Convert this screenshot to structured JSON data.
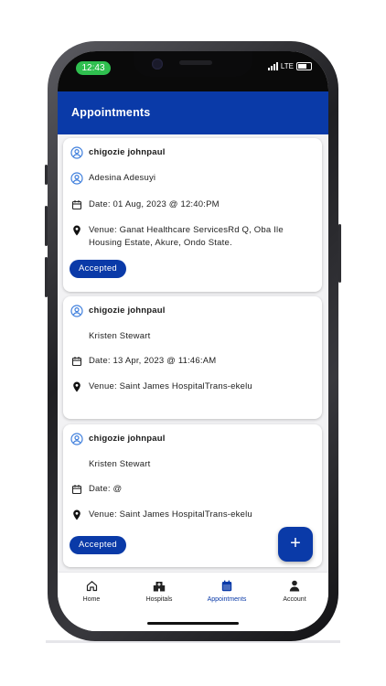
{
  "status_bar": {
    "time": "12:43",
    "network": "LTE"
  },
  "app_bar": {
    "title": "Appointments"
  },
  "appointments": [
    {
      "patient": "chigozie johnpaul",
      "doctor": "Adesina Adesuyi",
      "date": "Date: 01 Aug, 2023 @ 12:40:PM",
      "venue": "Venue: Ganat Healthcare ServicesRd Q, Oba Ile Housing Estate, Akure, Ondo State.",
      "status": "Accepted"
    },
    {
      "patient": "chigozie johnpaul",
      "doctor": "Kristen Stewart",
      "date": "Date: 13 Apr, 2023 @ 11:46:AM",
      "venue": "Venue: Saint James HospitalTrans-ekelu"
    },
    {
      "patient": "chigozie johnpaul",
      "doctor": "Kristen Stewart",
      "date": "Date:  @",
      "venue": "Venue: Saint James HospitalTrans-ekelu",
      "status": "Accepted"
    }
  ],
  "fab": {
    "label": "+"
  },
  "bottom_nav": {
    "items": [
      {
        "label": "Home",
        "icon": "home-icon"
      },
      {
        "label": "Hospitals",
        "icon": "hospital-icon"
      },
      {
        "label": "Appointments",
        "icon": "calendar-icon",
        "active": true
      },
      {
        "label": "Account",
        "icon": "person-icon"
      }
    ]
  },
  "colors": {
    "primary": "#0a3aa8",
    "status_pill": "#2fbf4f",
    "accent_icon": "#3f7fdc"
  }
}
